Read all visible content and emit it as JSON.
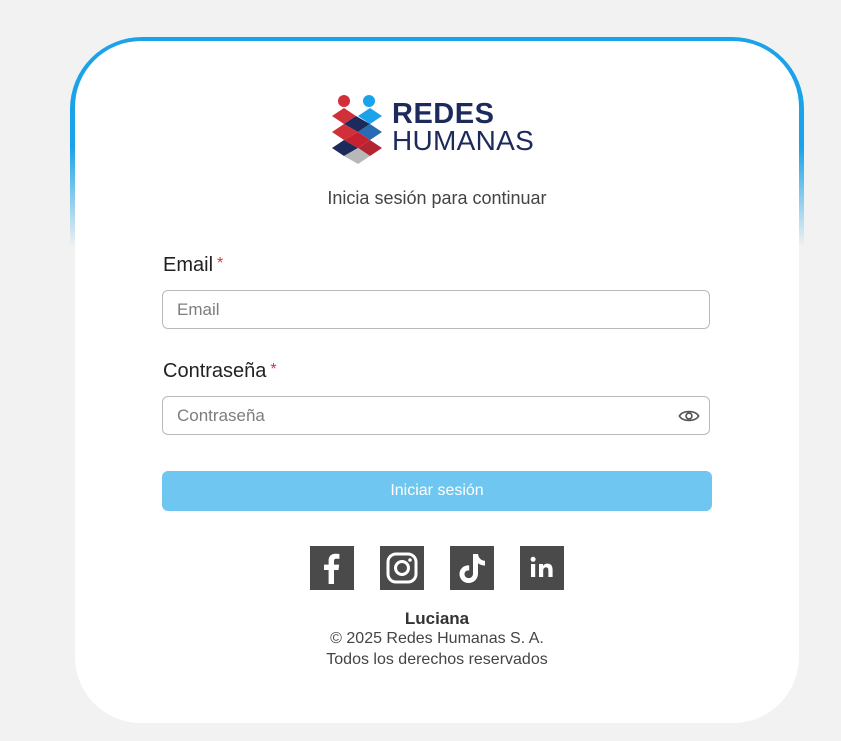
{
  "brand": {
    "line1": "REDES",
    "line2": "HUMANAS",
    "colors": {
      "navy": "#1d2a5c",
      "red": "#d12f3a",
      "blue": "#1aa3e8"
    }
  },
  "subtitle": "Inicia sesión para continuar",
  "form": {
    "email": {
      "label": "Email",
      "required_mark": "*",
      "placeholder": "Email",
      "value": ""
    },
    "password": {
      "label": "Contraseña",
      "required_mark": "*",
      "placeholder": "Contraseña",
      "value": "",
      "toggle_icon": "eye-icon"
    },
    "submit_label": "Iniciar sesión",
    "submit_color": "#6fc7f1"
  },
  "social": [
    {
      "name": "facebook",
      "icon": "facebook-icon"
    },
    {
      "name": "instagram",
      "icon": "instagram-icon"
    },
    {
      "name": "tiktok",
      "icon": "tiktok-icon"
    },
    {
      "name": "linkedin",
      "icon": "linkedin-icon"
    }
  ],
  "footer": {
    "user": "Luciana",
    "copyright": "© 2025 Redes Humanas S. A.",
    "rights": "Todos los derechos reservados"
  }
}
